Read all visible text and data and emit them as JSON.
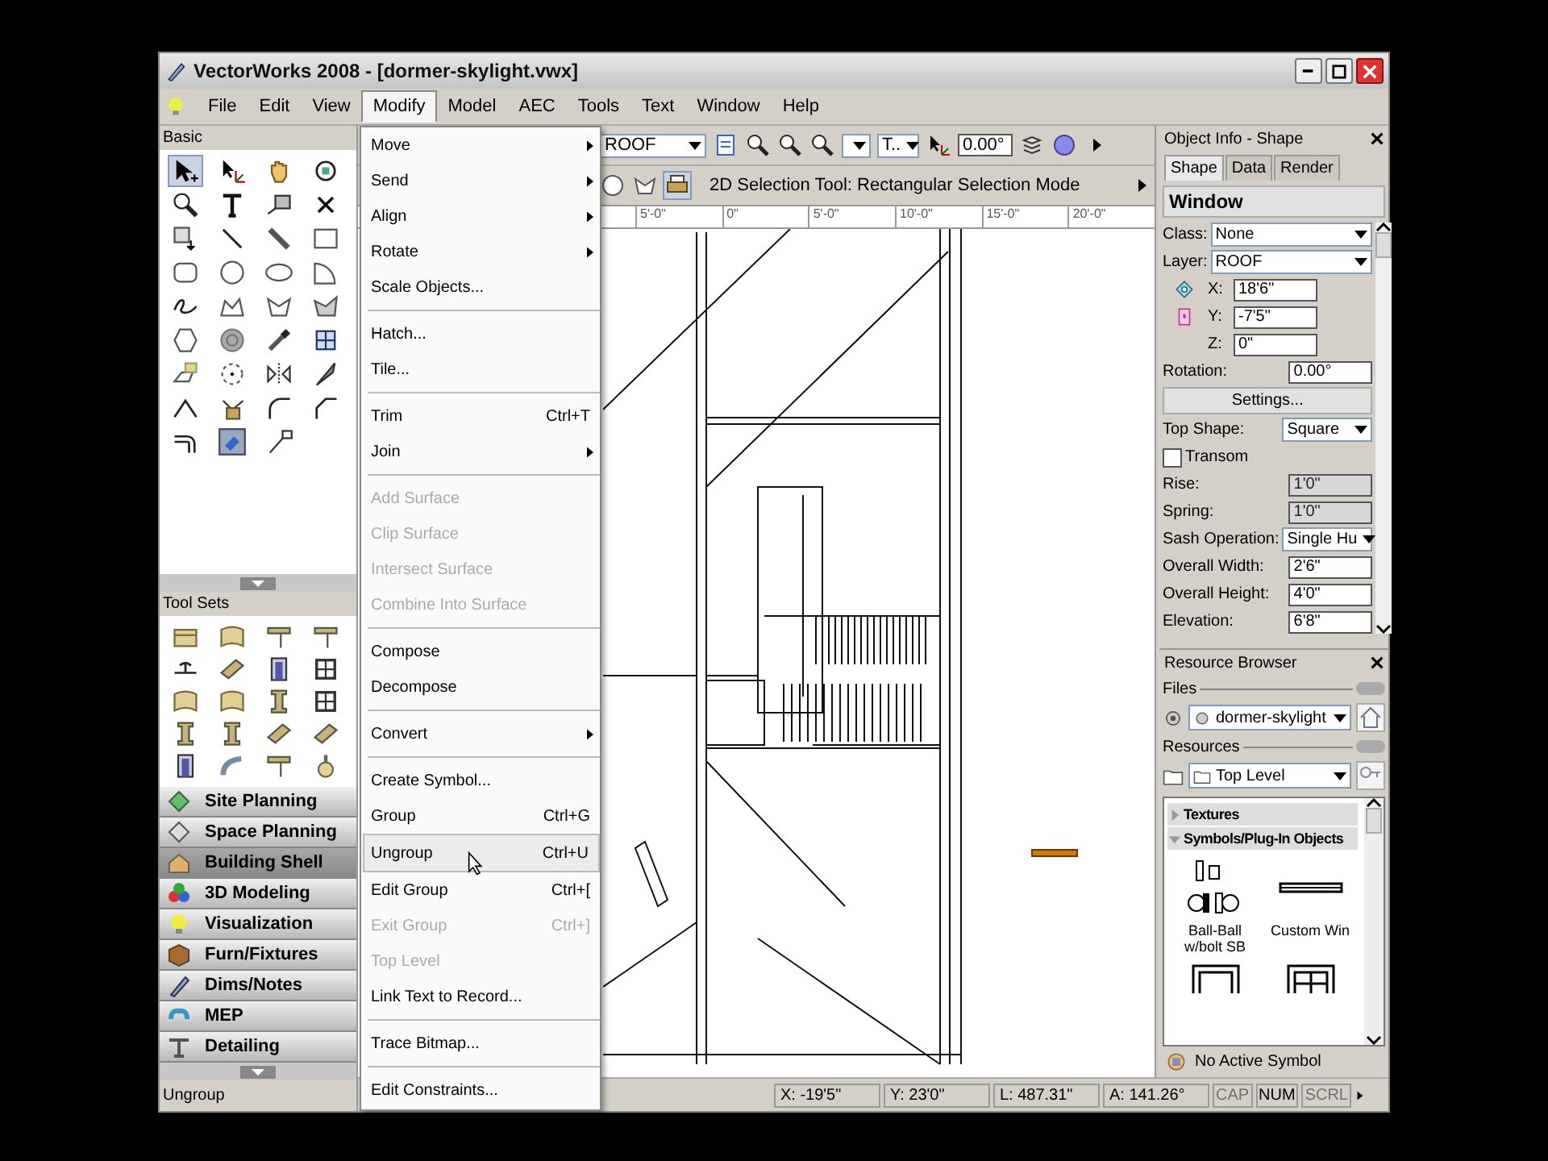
{
  "window": {
    "title": "VectorWorks 2008 - [dormer-skylight.vwx]"
  },
  "menu_bar": [
    {
      "label": "File",
      "selected": false
    },
    {
      "label": "Edit",
      "selected": false
    },
    {
      "label": "View",
      "selected": false
    },
    {
      "label": "Modify",
      "selected": true
    },
    {
      "label": "Model",
      "selected": false
    },
    {
      "label": "AEC",
      "selected": false
    },
    {
      "label": "Tools",
      "selected": false
    },
    {
      "label": "Text",
      "selected": false
    },
    {
      "label": "Window",
      "selected": false
    },
    {
      "label": "Help",
      "selected": false
    }
  ],
  "basic_palette": {
    "title": "Basic"
  },
  "tool_sets_palette": {
    "title": "Tool Sets",
    "sets": [
      {
        "label": "Site Planning",
        "selected": false
      },
      {
        "label": "Space Planning",
        "selected": false
      },
      {
        "label": "Building Shell",
        "selected": true
      },
      {
        "label": "3D Modeling",
        "selected": false
      },
      {
        "label": "Visualization",
        "selected": false
      },
      {
        "label": "Furn/Fixtures",
        "selected": false
      },
      {
        "label": "Dims/Notes",
        "selected": false
      },
      {
        "label": "MEP",
        "selected": false
      },
      {
        "label": "Detailing",
        "selected": false
      }
    ]
  },
  "palette_status": "Ungroup",
  "modify_menu": [
    {
      "kind": "item",
      "label": "Move",
      "submenu": true,
      "disabled": false,
      "selected": false
    },
    {
      "kind": "item",
      "label": "Send",
      "submenu": true,
      "disabled": false,
      "selected": false
    },
    {
      "kind": "item",
      "label": "Align",
      "submenu": true,
      "disabled": false,
      "selected": false
    },
    {
      "kind": "item",
      "label": "Rotate",
      "submenu": true,
      "disabled": false,
      "selected": false
    },
    {
      "kind": "item",
      "label": "Scale Objects...",
      "submenu": false,
      "disabled": false,
      "selected": false
    },
    {
      "kind": "separator"
    },
    {
      "kind": "item",
      "label": "Hatch...",
      "submenu": false,
      "disabled": false,
      "selected": false
    },
    {
      "kind": "item",
      "label": "Tile...",
      "submenu": false,
      "disabled": false,
      "selected": false
    },
    {
      "kind": "separator"
    },
    {
      "kind": "item",
      "label": "Trim",
      "shortcut": "Ctrl+T",
      "submenu": false,
      "disabled": false,
      "selected": false
    },
    {
      "kind": "item",
      "label": "Join",
      "submenu": true,
      "disabled": false,
      "selected": false
    },
    {
      "kind": "separator"
    },
    {
      "kind": "item",
      "label": "Add Surface",
      "submenu": false,
      "disabled": true,
      "selected": false
    },
    {
      "kind": "item",
      "label": "Clip Surface",
      "submenu": false,
      "disabled": true,
      "selected": false
    },
    {
      "kind": "item",
      "label": "Intersect Surface",
      "submenu": false,
      "disabled": true,
      "selected": false
    },
    {
      "kind": "item",
      "label": "Combine Into Surface",
      "submenu": false,
      "disabled": true,
      "selected": false
    },
    {
      "kind": "separator"
    },
    {
      "kind": "item",
      "label": "Compose",
      "submenu": false,
      "disabled": false,
      "selected": false
    },
    {
      "kind": "item",
      "label": "Decompose",
      "submenu": false,
      "disabled": false,
      "selected": false
    },
    {
      "kind": "separator"
    },
    {
      "kind": "item",
      "label": "Convert",
      "submenu": true,
      "disabled": false,
      "selected": false
    },
    {
      "kind": "separator"
    },
    {
      "kind": "item",
      "label": "Create Symbol...",
      "submenu": false,
      "disabled": false,
      "selected": false
    },
    {
      "kind": "item",
      "label": "Group",
      "shortcut": "Ctrl+G",
      "submenu": false,
      "disabled": false,
      "selected": false
    },
    {
      "kind": "item",
      "label": "Ungroup",
      "shortcut": "Ctrl+U",
      "submenu": false,
      "disabled": false,
      "selected": true
    },
    {
      "kind": "item",
      "label": "Edit Group",
      "shortcut": "Ctrl+[",
      "submenu": false,
      "disabled": false,
      "selected": false
    },
    {
      "kind": "item",
      "label": "Exit Group",
      "shortcut": "Ctrl+]",
      "submenu": false,
      "disabled": true,
      "selected": false
    },
    {
      "kind": "item",
      "label": "Top Level",
      "submenu": false,
      "disabled": true,
      "selected": false
    },
    {
      "kind": "item",
      "label": "Link Text to Record...",
      "submenu": false,
      "disabled": false,
      "selected": false
    },
    {
      "kind": "separator"
    },
    {
      "kind": "item",
      "label": "Trace Bitmap...",
      "submenu": false,
      "disabled": false,
      "selected": false
    },
    {
      "kind": "separator"
    },
    {
      "kind": "item",
      "label": "Edit Constraints...",
      "submenu": false,
      "disabled": false,
      "selected": false
    }
  ],
  "view_bar": {
    "layer": "ROOF",
    "text_style": "T..",
    "angle": "0.00°"
  },
  "mode_bar": {
    "mode": "2D Selection Tool: Rectangular Selection Mode"
  },
  "ruler": [
    "5'-0\"",
    "0\"",
    "5'-0\"",
    "10'-0\"",
    "15'-0\"",
    "20'-0\""
  ],
  "object_info": {
    "title": "Object Info - Shape",
    "tabs": [
      {
        "label": "Shape",
        "selected": true
      },
      {
        "label": "Data",
        "selected": false
      },
      {
        "label": "Render",
        "selected": false
      }
    ],
    "object_type": "Window",
    "fields": [
      {
        "kind": "dropdown",
        "label": "Class:",
        "value": "None",
        "disabled": false
      },
      {
        "kind": "dropdown",
        "label": "Layer:",
        "value": "ROOF",
        "disabled": false
      },
      {
        "kind": "coord",
        "label": "X:",
        "value": "18'6\"",
        "disabled": false
      },
      {
        "kind": "coord",
        "label": "Y:",
        "value": "-7'5\"",
        "disabled": false
      },
      {
        "kind": "coord",
        "label": "Z:",
        "value": "0\"",
        "disabled": false
      },
      {
        "kind": "field",
        "label": "Rotation:",
        "value": "0.00°",
        "disabled": false
      },
      {
        "kind": "button",
        "label": "Settings...",
        "disabled": false
      },
      {
        "kind": "dropdown",
        "label": "Top Shape:",
        "value": "Square",
        "disabled": false
      },
      {
        "kind": "checkbox",
        "label": "Transom",
        "checked": false,
        "disabled": false
      },
      {
        "kind": "field",
        "label": "Rise:",
        "value": "1'0\"",
        "disabled": true
      },
      {
        "kind": "field",
        "label": "Spring:",
        "value": "1'0\"",
        "disabled": true
      },
      {
        "kind": "dropdown",
        "label": "Sash Operation:",
        "value": "Single Hu",
        "disabled": false
      },
      {
        "kind": "field",
        "label": "Overall Width:",
        "value": "2'6\"",
        "disabled": false
      },
      {
        "kind": "field",
        "label": "Overall Height:",
        "value": "4'0\"",
        "disabled": false
      },
      {
        "kind": "field",
        "label": "Elevation:",
        "value": "6'8\"",
        "disabled": false
      }
    ]
  },
  "resource_browser": {
    "title": "Resource Browser",
    "files_label": "Files",
    "file": "dormer-skylight",
    "resources_label": "Resources",
    "folder": "Top Level",
    "groups": [
      {
        "label": "Textures",
        "expanded": false
      },
      {
        "label": "Symbols/Plug-In Objects",
        "expanded": true
      }
    ],
    "symbols": [
      {
        "label": "Ball-Ball w/bolt SB"
      },
      {
        "label": "Custom Win"
      }
    ],
    "active_symbol": "No Active Symbol"
  },
  "status_bar": {
    "readouts": [
      "X: -19'5\"",
      "Y: 23'0\"",
      "L: 487.31\"",
      "A: 141.26°"
    ],
    "indicators": [
      {
        "label": "CAP",
        "on": false
      },
      {
        "label": "NUM",
        "on": true
      },
      {
        "label": "SCRL",
        "on": false
      }
    ]
  }
}
